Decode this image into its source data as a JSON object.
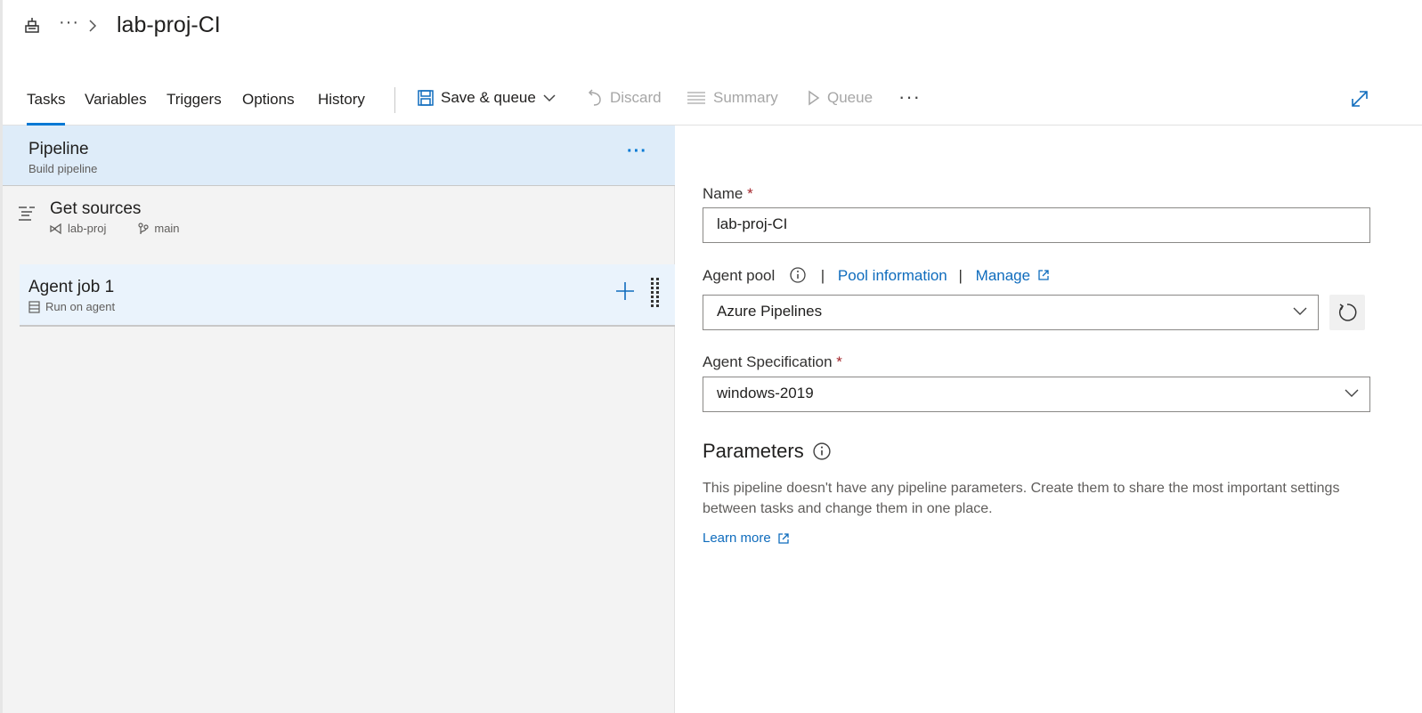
{
  "header": {
    "more_crumb": "···",
    "title": "lab-proj-CI"
  },
  "toolbar": {
    "tabs": [
      {
        "label": "Tasks"
      },
      {
        "label": "Variables"
      },
      {
        "label": "Triggers"
      },
      {
        "label": "Options"
      },
      {
        "label": "History"
      }
    ],
    "save_queue_label": "Save & queue",
    "discard_label": "Discard",
    "summary_label": "Summary",
    "queue_label": "Queue",
    "more_label": "···"
  },
  "left": {
    "pipeline": {
      "title": "Pipeline",
      "subtitle": "Build pipeline",
      "more": "···"
    },
    "sources": {
      "title": "Get sources",
      "repo": "lab-proj",
      "branch": "main"
    },
    "job": {
      "title": "Agent job 1",
      "subtitle": "Run on agent"
    }
  },
  "right": {
    "name_label": "Name",
    "required_mark": "*",
    "name_value": "lab-proj-CI",
    "agent_pool_label": "Agent pool",
    "separator": "|",
    "pool_info_link": "Pool information",
    "manage_link": "Manage",
    "agent_pool_value": "Azure Pipelines",
    "agent_spec_label": "Agent Specification",
    "agent_spec_value": "windows-2019",
    "parameters_heading": "Parameters",
    "parameters_text": "This pipeline doesn't have any pipeline parameters. Create them to share the most important settings between tasks and change them in one place.",
    "learn_more": "Learn more"
  },
  "colors": {
    "accent": "#0078d4",
    "link": "#0f6cbd",
    "selected_bg": "#deecf9",
    "panel_bg": "#f3f3f3",
    "required": "#a4262c"
  }
}
